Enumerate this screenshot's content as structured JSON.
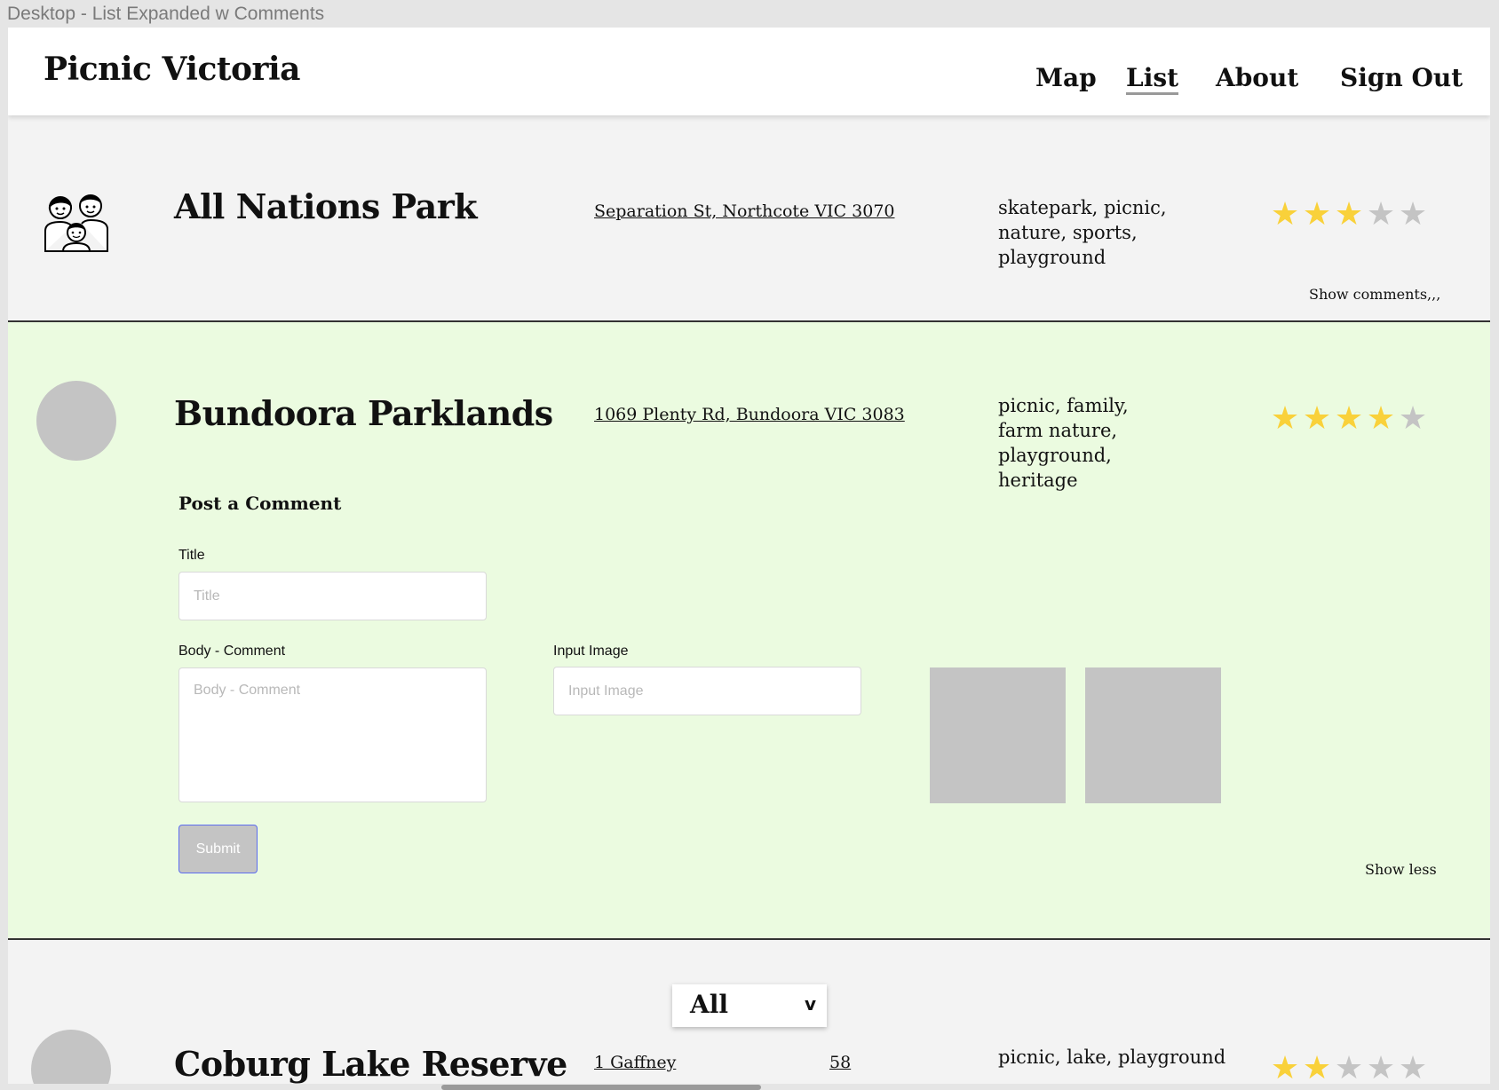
{
  "frame_label": "Desktop - List Expanded w Comments",
  "header": {
    "brand": "Picnic Victoria",
    "nav": [
      {
        "label": "Map",
        "active": false
      },
      {
        "label": "List",
        "active": true
      },
      {
        "label": "About",
        "active": false
      },
      {
        "label": "Sign Out",
        "active": false
      }
    ]
  },
  "parks": [
    {
      "name": "All Nations Park",
      "address": "Separation St, Northcote VIC 3070",
      "tags": "skatepark, picnic, nature, sports, playground",
      "rating": 3,
      "rating_max": 5,
      "icon": "family-icon",
      "toggle": "Show comments,,,"
    },
    {
      "name": "Bundoora Parklands",
      "address": "1069 Plenty Rd, Bundoora VIC 3083",
      "tags": "picnic, family, farm nature, playground, heritage",
      "rating": 4,
      "rating_max": 5,
      "icon": "avatar-placeholder",
      "toggle": "Show less",
      "comment_form": {
        "heading": "Post a Comment",
        "title_label": "Title",
        "title_placeholder": "Title",
        "body_label": "Body - Comment",
        "body_placeholder": "Body - Comment",
        "image_label": "Input Image",
        "image_placeholder": "Input Image",
        "submit_label": "Submit"
      }
    },
    {
      "name": "Coburg Lake Reserve",
      "address_visible_start": "1 Gaffney",
      "address_visible_end": "58",
      "tags": "picnic, lake, playground",
      "rating": 2,
      "rating_max": 5,
      "icon": "avatar-placeholder"
    }
  ],
  "filter": {
    "value": "All",
    "chevron": "v"
  },
  "colors": {
    "star_on": "#f9d13a",
    "star_off": "#c4c4c4",
    "expanded_row_bg": "#ebfbe0",
    "row_bg": "#f3f3f3",
    "submit_border": "#5c6cf0"
  }
}
